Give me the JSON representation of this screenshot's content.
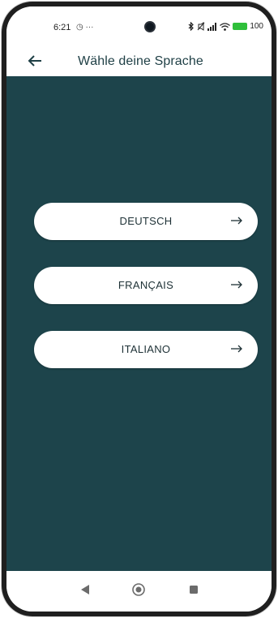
{
  "status_bar": {
    "time": "6:21",
    "extra": "◷ ···",
    "battery_label": "100"
  },
  "header": {
    "title": "Wähle deine Sprache"
  },
  "languages": [
    {
      "label": "DEUTSCH",
      "arrow_icon": "arrow-right-icon"
    },
    {
      "label": "FRANÇAIS",
      "arrow_icon": "arrow-right-icon"
    },
    {
      "label": "ITALIANO",
      "arrow_icon": "arrow-right-icon"
    }
  ],
  "colors": {
    "background": "#1d444b",
    "title": "#1e3f45",
    "button": "#ffffff"
  },
  "icons": {
    "back": "arrow-left-icon",
    "nav_back": "triangle-back-icon",
    "nav_home": "circle-home-icon",
    "nav_recents": "square-recents-icon"
  }
}
